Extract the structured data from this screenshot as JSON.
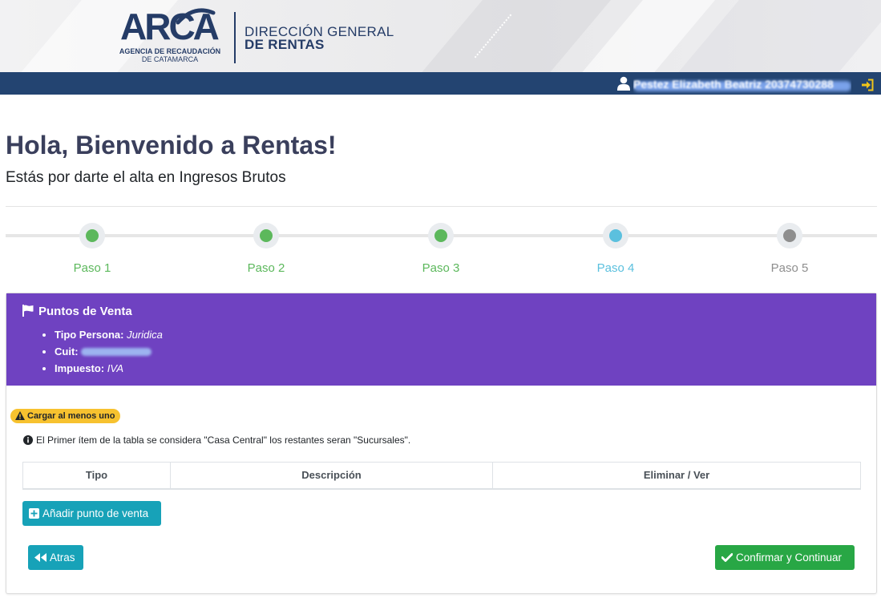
{
  "banner": {
    "logo_text": "ARCA",
    "agency_line1": "AGENCIA DE RECAUDACIÓN",
    "agency_line2": "DE CATAMARCA",
    "direction_line1": "DIRECCIÓN GENERAL",
    "direction_line2": "DE RENTAS"
  },
  "topbar": {
    "user_name": "Pestez Elizabeth Beatriz 20374730288",
    "user_icon": "user-icon",
    "logout_icon": "sign-in-icon"
  },
  "header": {
    "title": "Hola, Bienvenido a Rentas!",
    "subtitle": "Estás por darte el alta en Ingresos Brutos"
  },
  "stepper": {
    "steps": [
      {
        "label": "Paso 1",
        "status": "done",
        "color": "#5cb85c"
      },
      {
        "label": "Paso 2",
        "status": "done",
        "color": "#5cb85c"
      },
      {
        "label": "Paso 3",
        "status": "done",
        "color": "#5cb85c"
      },
      {
        "label": "Paso 4",
        "status": "current",
        "color": "#5bc0de"
      },
      {
        "label": "Paso 5",
        "status": "pending",
        "color": "#8e8e8e"
      }
    ]
  },
  "card": {
    "title": "Puntos de Venta",
    "title_icon": "flag-icon",
    "header_color": "#6f42c1",
    "info": {
      "tipo_persona_label": "Tipo Persona:",
      "tipo_persona_value": "Juridica",
      "cuit_label": "Cuit:",
      "cuit_value": "30717302288",
      "impuesto_label": "Impuesto:",
      "impuesto_value": "IVA"
    },
    "warning_badge": "Cargar al menos uno",
    "info_note": "El Primer ítem de la tabla se considera \"Casa Central\" los restantes seran \"Sucursales\".",
    "table": {
      "columns": [
        "Tipo",
        "Descripción",
        "Eliminar / Ver"
      ],
      "rows": []
    },
    "buttons": {
      "add": "Añadir punto de venta",
      "back": "Atras",
      "next": "Confirmar y Continuar"
    }
  },
  "colors": {
    "navy": "#234471",
    "purple": "#6f42c1",
    "info": "#17a2b8",
    "success": "#28a745",
    "warning": "#f7c22f"
  }
}
